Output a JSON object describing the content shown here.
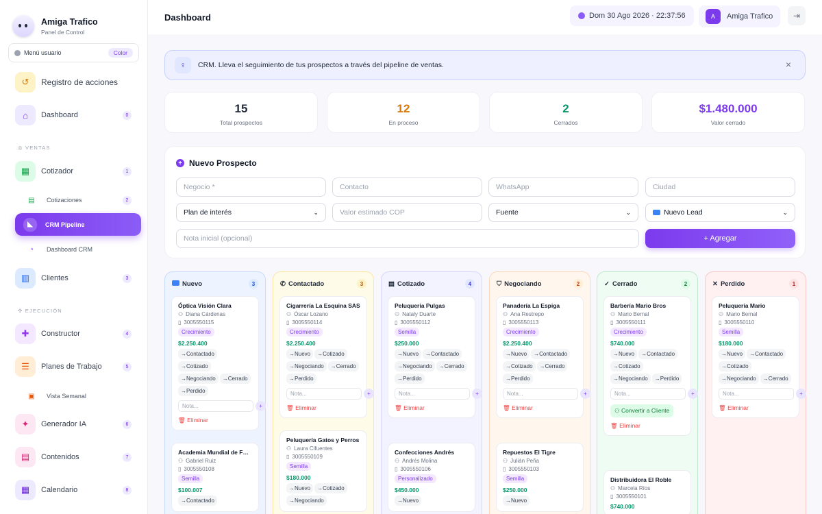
{
  "sidebar": {
    "brand": "Amiga Trafico",
    "brand_sub": "Panel de Control",
    "menu_user": "Menú usuario",
    "menu_user_badge": "Color",
    "section_ventas": "VENTAS",
    "section_ejecucion": "EJECUCIÓN",
    "items": [
      {
        "label": "Registro de acciones"
      },
      {
        "label": "Dashboard",
        "count": "0"
      },
      {
        "label": "Cotizador",
        "count": "1"
      },
      {
        "label": "Cotizaciones",
        "count": "2"
      },
      {
        "label": "CRM Pipeline"
      },
      {
        "label": "Dashboard CRM"
      },
      {
        "label": "Clientes",
        "count": "3"
      },
      {
        "label": "Constructor",
        "count": "4"
      },
      {
        "label": "Planes de Trabajo",
        "count": "5"
      },
      {
        "label": "Vista Semanal"
      },
      {
        "label": "Generador IA",
        "count": "6"
      },
      {
        "label": "Contenidos",
        "count": "7"
      },
      {
        "label": "Calendario",
        "count": "8"
      }
    ]
  },
  "header": {
    "title": "Dashboard",
    "datetime": "Dom 30 Ago 2026 · 22:37:56",
    "user_initial": "A",
    "user_name": "Amiga Trafico"
  },
  "banner": {
    "text": "CRM. Lleva el seguimiento de tus prospectos a través del pipeline de ventas."
  },
  "stats": [
    {
      "value": "15",
      "label": "Total prospectos",
      "color": "#1f2937"
    },
    {
      "value": "12",
      "label": "En proceso",
      "color": "#d97706"
    },
    {
      "value": "2",
      "label": "Cerrados",
      "color": "#059669"
    },
    {
      "value": "$1.480.000",
      "label": "Valor cerrado",
      "color": "#7c3aed"
    }
  ],
  "form": {
    "title": "Nuevo Prospecto",
    "negocio_ph": "Negocio *",
    "contacto_ph": "Contacto",
    "whatsapp_ph": "WhatsApp",
    "ciudad_ph": "Ciudad",
    "plan": "Plan de interés",
    "valor_ph": "Valor estimado COP",
    "fuente": "Fuente",
    "estado": "Nuevo Lead",
    "nota_ph": "Nota inicial (opcional)",
    "add": "+ Agregar"
  },
  "common": {
    "note_ph": "Nota...",
    "delete": "Eliminar",
    "convert": "Convertir a Cliente"
  },
  "columns": [
    {
      "name": "Nuevo",
      "count": "3",
      "icon": "new-badge-icon",
      "cards": [
        {
          "name": "Óptica Visión Clara",
          "contact": "Diana Cárdenas",
          "phone": "3005550115",
          "tag": "Crecimiento",
          "price": "$2.250.400",
          "moves": [
            "→Contactado",
            "→Cotizado",
            "→Negociando",
            "→Cerrado",
            "→Perdido"
          ]
        },
        {
          "name": "Academia Mundial de Fút...",
          "contact": "Gabriel Ruiz",
          "phone": "3005550108",
          "tag": "Semilla",
          "price": "$100.007",
          "moves": [
            "→Contactado"
          ]
        }
      ]
    },
    {
      "name": "Contactado",
      "count": "3",
      "icon": "phone-icon",
      "cards": [
        {
          "name": "Cigarrería La Esquina SAS",
          "contact": "Óscar Lozano",
          "phone": "3005550114",
          "tag": "Crecimiento",
          "price": "$2.250.400",
          "moves": [
            "→Nuevo",
            "→Cotizado",
            "→Negociando",
            "→Cerrado",
            "→Perdido"
          ]
        },
        {
          "name": "Peluquería Gatos y Perros",
          "contact": "Laura Cifuentes",
          "phone": "3005550109",
          "tag": "Semilla",
          "price": "$180.000",
          "moves": [
            "→Nuevo",
            "→Cotizado",
            "→Negociando"
          ]
        }
      ]
    },
    {
      "name": "Cotizado",
      "count": "4",
      "icon": "document-icon",
      "cards": [
        {
          "name": "Peluquería Pulgas",
          "contact": "Nataly Duarte",
          "phone": "3005550112",
          "tag": "Semilla",
          "price": "$250.000",
          "moves": [
            "→Nuevo",
            "→Contactado",
            "→Negociando",
            "→Cerrado",
            "→Perdido"
          ]
        },
        {
          "name": "Confecciones Andrés",
          "contact": "Andrés Molina",
          "phone": "3005550106",
          "tag": "Personalizado",
          "price": "$450.000",
          "moves": [
            "→Nuevo"
          ]
        }
      ]
    },
    {
      "name": "Negociando",
      "count": "2",
      "icon": "handshake-icon",
      "cards": [
        {
          "name": "Panadería La Espiga",
          "contact": "Ana Restrepo",
          "phone": "3005550113",
          "tag": "Crecimiento",
          "price": "$2.250.400",
          "moves": [
            "→Nuevo",
            "→Contactado",
            "→Cotizado",
            "→Cerrado",
            "→Perdido"
          ]
        },
        {
          "name": "Repuestos El Tigre",
          "contact": "Julián Peña",
          "phone": "3005550103",
          "tag": "Semilla",
          "price": "$250.000",
          "moves": [
            "→Nuevo"
          ]
        }
      ]
    },
    {
      "name": "Cerrado",
      "count": "2",
      "icon": "check-circle-icon",
      "cards": [
        {
          "name": "Barbería Mario Bros",
          "contact": "Mario Bernal",
          "phone": "3005550111",
          "tag": "Crecimiento",
          "price": "$740.000",
          "moves": [
            "→Nuevo",
            "→Contactado",
            "→Cotizado",
            "→Negociando",
            "→Perdido"
          ]
        },
        {
          "name": "Distribuidora El Roble",
          "contact": "Marcela Ríos",
          "phone": "3005550101",
          "price": "$740.000",
          "moves": []
        }
      ]
    },
    {
      "name": "Perdido",
      "count": "1",
      "icon": "x-icon",
      "cards": [
        {
          "name": "Peluquería Mario",
          "contact": "Mario Bernal",
          "phone": "3005550110",
          "tag": "Semilla",
          "price": "$180.000",
          "moves": [
            "→Nuevo",
            "→Contactado",
            "→Cotizado",
            "→Negociando",
            "→Cerrado"
          ]
        }
      ]
    }
  ]
}
